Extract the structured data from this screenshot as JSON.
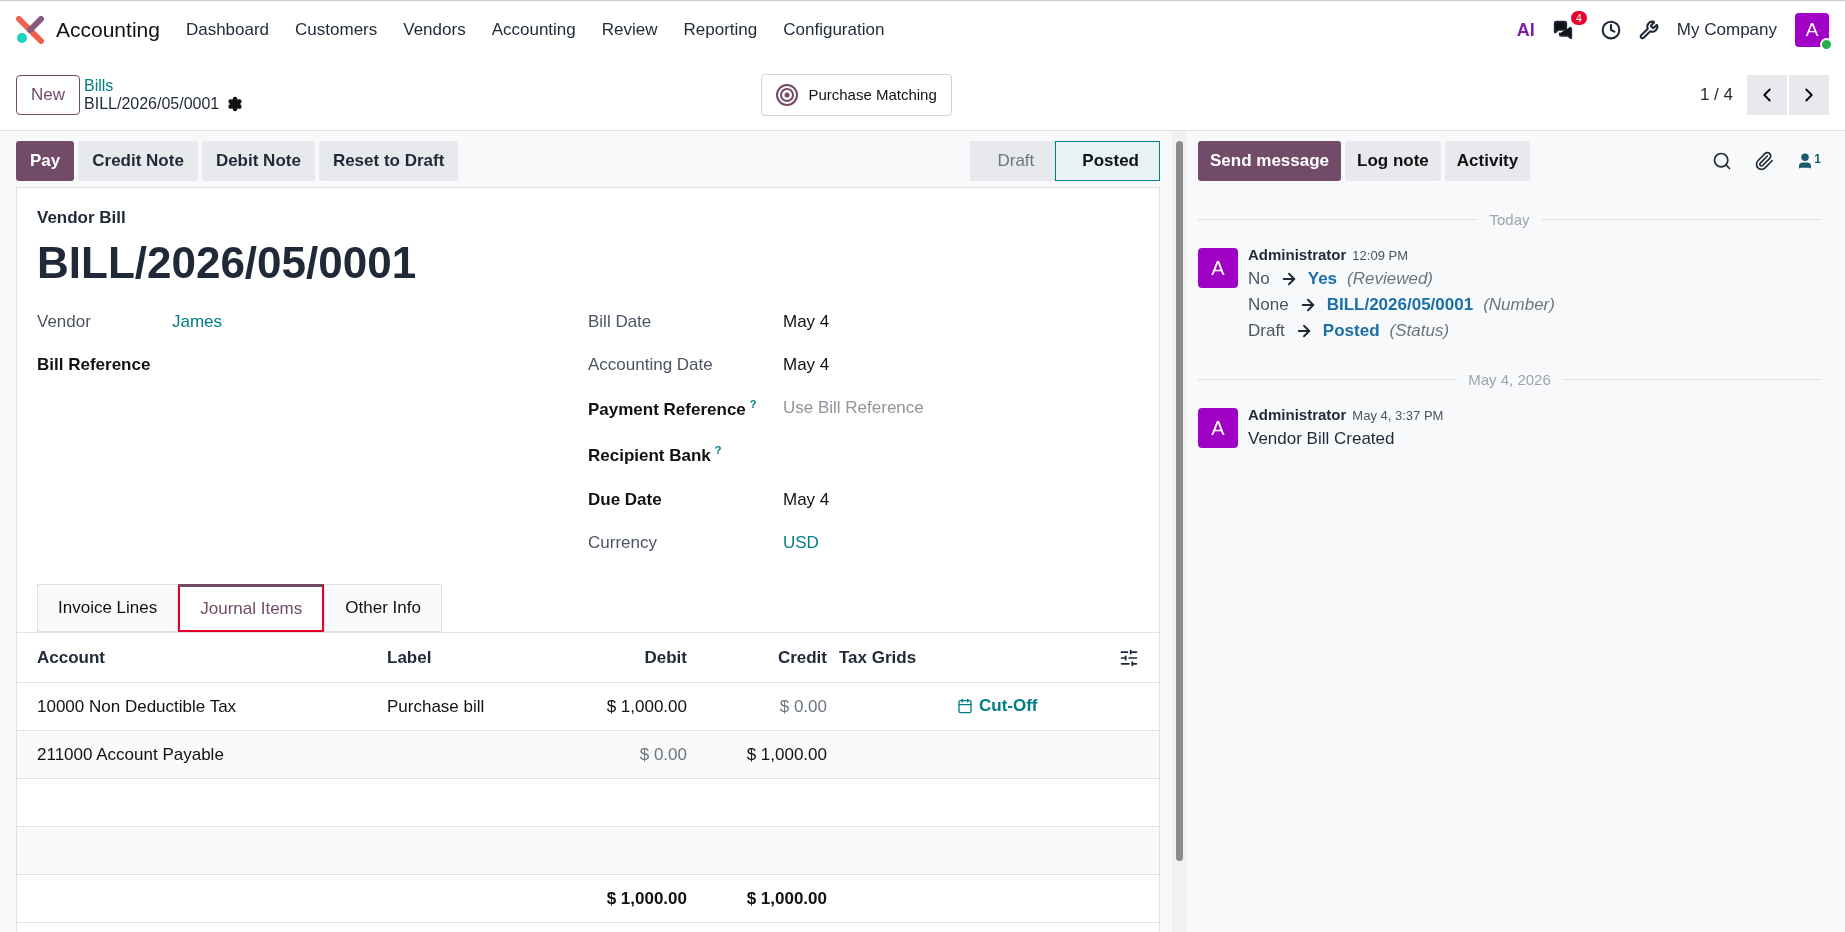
{
  "navbar": {
    "app": "Accounting",
    "menu": [
      "Dashboard",
      "Customers",
      "Vendors",
      "Accounting",
      "Review",
      "Reporting",
      "Configuration"
    ],
    "ai_label": "AI",
    "message_count": "4",
    "company": "My Company",
    "avatar": "A"
  },
  "control_panel": {
    "new_button": "New",
    "breadcrumb": "Bills",
    "record": "BILL/2026/05/0001",
    "center_button": "Purchase Matching",
    "pager": "1 / 4"
  },
  "actions": [
    "Pay",
    "Credit Note",
    "Debit Note",
    "Reset to Draft"
  ],
  "status": [
    {
      "label": "Draft",
      "selected": false
    },
    {
      "label": "Posted",
      "selected": true
    }
  ],
  "form": {
    "type": "Vendor Bill",
    "title": "BILL/2026/05/0001",
    "left_fields": [
      {
        "label": "Vendor",
        "value": "James",
        "bold": false,
        "help": false,
        "link": true
      },
      {
        "label": "Bill Reference",
        "bold": true,
        "help": false
      }
    ],
    "right_fields": [
      {
        "label": "Bill Date",
        "value": "May 4",
        "bold": false,
        "help": false,
        "link": false
      },
      {
        "label": "Accounting Date",
        "value": "May 4",
        "bold": false,
        "help": false,
        "link": false
      },
      {
        "label": "Payment Reference",
        "placeholder": "Use Bill Reference",
        "bold": true,
        "help": true
      },
      {
        "label": "Recipient Bank",
        "bold": true,
        "help": true
      },
      {
        "label": "Due Date",
        "value": "May 4",
        "bold": true,
        "help": false,
        "link": false
      },
      {
        "label": "Currency",
        "value": "USD",
        "bold": false,
        "help": false,
        "link": true
      }
    ],
    "help_mark": "?",
    "tabs": [
      {
        "label": "Invoice Lines",
        "selected": false,
        "highlighted": false
      },
      {
        "label": "Journal Items",
        "selected": true,
        "highlighted": true
      },
      {
        "label": "Other Info",
        "selected": false,
        "highlighted": false
      }
    ],
    "table": {
      "columns": [
        "Account",
        "Label",
        "Debit",
        "Credit",
        "Tax Grids"
      ],
      "rows": [
        {
          "account": "10000 Non Deductible Tax",
          "label": "Purchase bill",
          "debit": "$ 1,000.00",
          "debit_zero": false,
          "credit": "$ 0.00",
          "credit_zero": true,
          "action": "Cut-Off"
        },
        {
          "account": "211000 Account Payable",
          "debit": "$ 0.00",
          "debit_zero": true,
          "credit": "$ 1,000.00",
          "credit_zero": false
        }
      ],
      "totals": {
        "debit": "$ 1,000.00",
        "credit": "$ 1,000.00"
      }
    }
  },
  "chatter": {
    "buttons": [
      {
        "label": "Send message",
        "selected": true
      },
      {
        "label": "Log note",
        "selected": false
      },
      {
        "label": "Activity",
        "selected": false
      }
    ],
    "followers": "1",
    "groups": [
      {
        "date": "Today",
        "messages": [
          {
            "author": "Administrator",
            "avatar": "A",
            "time": "12:09 PM",
            "changes": [
              {
                "old": "No",
                "new": "Yes",
                "field": "(Reviewed)"
              },
              {
                "old": "None",
                "new": "BILL/2026/05/0001",
                "field": "(Number)"
              },
              {
                "old": "Draft",
                "new": "Posted",
                "field": "(Status)"
              }
            ]
          }
        ]
      },
      {
        "date": "May 4, 2026",
        "messages": [
          {
            "author": "Administrator",
            "avatar": "A",
            "time": "May 4, 3:37 PM",
            "body": "Vendor Bill Created"
          }
        ]
      }
    ]
  }
}
